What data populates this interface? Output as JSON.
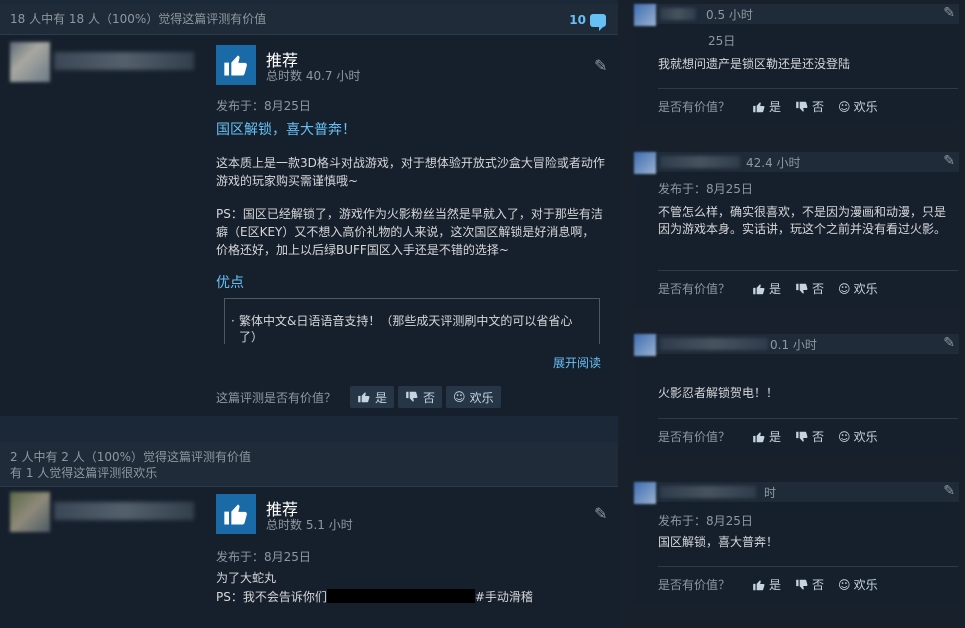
{
  "reviews": [
    {
      "helpful_summary": "18 人中有 18 人（100%）觉得这篇评测有价值",
      "comment_count": "10",
      "recommendation": "推荐",
      "hours": "总时数 40.7 小时",
      "posted": "发布于：8月25日",
      "title": "国区解锁，喜大普奔！",
      "paragraph1": "这本质上是一款3D格斗对战游戏，对于想体验开放式沙盒大冒险或者动作游戏的玩家购买需谨慎哦~",
      "paragraph2": "PS：国区已经解锁了，游戏作为火影粉丝当然是早就入了，对于那些有洁癖（E区KEY）又不想入高价礼物的人来说，这次国区解锁是好消息啊，价格还好，加上以后绿BUFF国区入手还是不错的选择~",
      "pros_title": "优点",
      "pros_item": "繁体中文&日语语音支持！（那些成天评测刷中文的可以省省心了）",
      "expand_label": "展开阅读",
      "helpful_question": "这篇评测是否有价值？",
      "yes_label": "是",
      "no_label": "否",
      "funny_label": "欢乐"
    },
    {
      "helpful_summary": "2 人中有 2 人（100%）觉得这篇评测有价值",
      "funny_summary": "有 1 人觉得这篇评测很欢乐",
      "recommendation": "推荐",
      "hours": "总时数 5.1 小时",
      "posted": "发布于：8月25日",
      "line1": "为了大蛇丸",
      "line2_prefix": "PS：我不会告诉你们",
      "line2_suffix": "#手动滑稽"
    }
  ],
  "side_reviews": [
    {
      "hours": "0.5 小时",
      "posted_partial": "25日",
      "text": "我就想问遗产是锁区勒还是还没登陆",
      "helpful_question": "是否有价值？",
      "yes_label": "是",
      "no_label": "否",
      "funny_label": "欢乐"
    },
    {
      "hours": "42.4 小时",
      "posted": "发布于：8月25日",
      "text": "不管怎么样，确实很喜欢，不是因为漫画和动漫，只是因为游戏本身。实话讲，玩这个之前并没有看过火影。",
      "helpful_question": "是否有价值？",
      "yes_label": "是",
      "no_label": "否",
      "funny_label": "欢乐"
    },
    {
      "hours": "0.1 小时",
      "text": "火影忍者解锁贺电！！",
      "helpful_question": "是否有价值？",
      "yes_label": "是",
      "no_label": "否",
      "funny_label": "欢乐"
    },
    {
      "hours": "时",
      "posted": "发布于：8月25日",
      "text": "国区解锁，喜大普奔！",
      "helpful_question": "是否有价值？",
      "yes_label": "是",
      "no_label": "否",
      "funny_label": "欢乐"
    }
  ],
  "icons": {
    "thumbs_up": "thumbs-up-icon",
    "thumbs_down": "thumbs-down-icon",
    "smiley": "smiley-icon",
    "award": "award-icon",
    "comment": "comment-icon"
  },
  "colors": {
    "background": "#1b2838",
    "accent": "#66c0f4",
    "recommend_box": "#1a6aa8"
  }
}
